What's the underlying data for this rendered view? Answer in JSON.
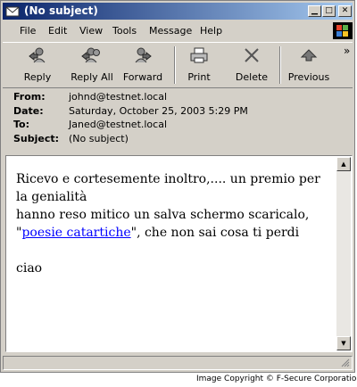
{
  "window": {
    "title": "(No subject)"
  },
  "menus": [
    "File",
    "Edit",
    "View",
    "Tools",
    "Message",
    "Help"
  ],
  "toolbar": {
    "reply": "Reply",
    "reply_all": "Reply All",
    "forward": "Forward",
    "print": "Print",
    "delete": "Delete",
    "previous": "Previous",
    "more": "»"
  },
  "headers": [
    {
      "label": "From:",
      "value": "johnd@testnet.local"
    },
    {
      "label": "Date:",
      "value": "Saturday, October 25, 2003 5:29 PM"
    },
    {
      "label": "To:",
      "value": "Janed@testnet.local"
    },
    {
      "label": "Subject:",
      "value": "(No subject)"
    }
  ],
  "message": {
    "line1": "Ricevo e cortesemente inoltro,.... un premio per la genialità",
    "line2": "hanno reso mitico un salva schermo scaricalo,",
    "quote_open": "\"",
    "link_text": "poesie catartiche",
    "after_link": "\", che non sai cosa ti perdi",
    "signoff": "ciao"
  },
  "footer": {
    "copyright": "Image Copyright © F-Secure Corporation"
  },
  "icons": [
    "app-icon",
    "minimize-icon",
    "maximize-icon",
    "close-icon",
    "windows-logo-icon",
    "reply-icon",
    "reply-all-icon",
    "forward-icon",
    "print-icon",
    "delete-icon",
    "previous-icon",
    "scroll-up-icon",
    "scroll-down-icon"
  ]
}
